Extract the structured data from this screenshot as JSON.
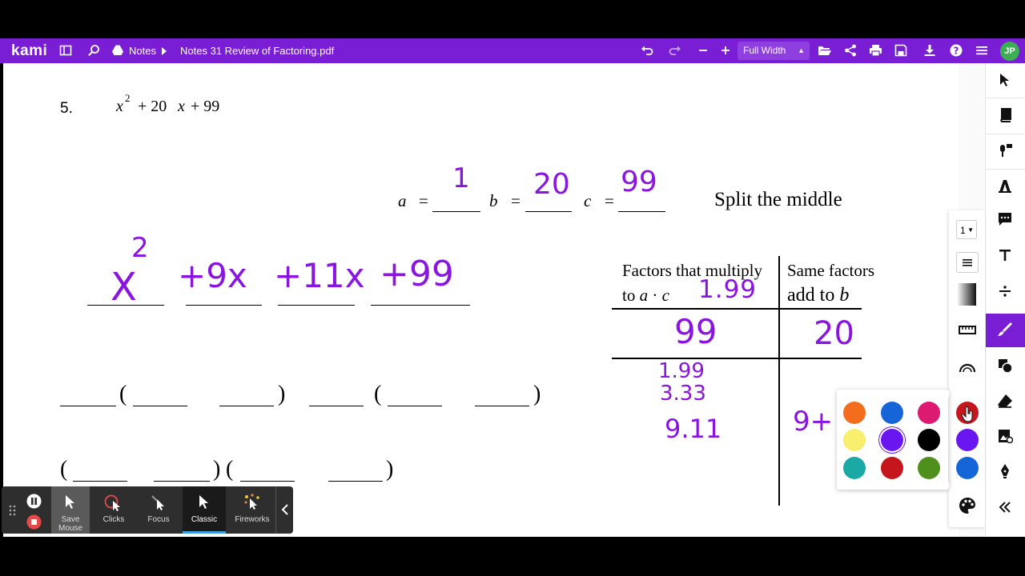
{
  "toolbar": {
    "logo": "kami",
    "breadcrumb_folder": "Notes",
    "file_name": "Notes 31  Review of Factoring.pdf",
    "zoom": "Full Width",
    "avatar_initials": "JP",
    "accent_color": "#7a1ed6"
  },
  "problem": {
    "number": "5.",
    "var": "x",
    "exp": "2",
    "rest": "+ 20",
    "rest_var": "x",
    "rest_tail": "+ 99",
    "split_label": "Split the middle",
    "a_label": "a",
    "b_label": "b",
    "c_label": "c",
    "eq": "="
  },
  "handwriting": {
    "a_value": "1",
    "b_value": "20",
    "c_value": "99",
    "term1": "X",
    "term1_exp": "2",
    "term2": "+9x",
    "term3": "+11x",
    "term4": "+99",
    "ac_product": "1.99",
    "table_left_value": "99",
    "table_right_value": "20",
    "factor_pairs": [
      "1.99",
      "3.33",
      "9.11"
    ],
    "partial_sum": "9+"
  },
  "table": {
    "col1_line1": "Factors that multiply",
    "col1_line2_prefix": "to",
    "col1_a": "a",
    "col1_dot": "·",
    "col1_c": "c",
    "col2_line1": "Same factors",
    "col2_line2_prefix": "add to",
    "col2_b": "b"
  },
  "layout_text": {
    "paren_open": "(",
    "paren_close": ")"
  },
  "subtools": {
    "stroke_size": "1"
  },
  "palette": {
    "colors": [
      "#f36d1c",
      "#1565d8",
      "#dd1a72",
      "#c4161c",
      "#f7ef6d",
      "#6a16f0",
      "#000000",
      "#6a16f0",
      "#1aa9a5",
      "#c4161c",
      "#4f8f1b",
      "#1565d8"
    ]
  },
  "recorder": {
    "save_mouse": "Save Mouse",
    "clicks": "Clicks",
    "focus": "Focus",
    "classic": "Classic",
    "fireworks": "Fireworks"
  }
}
